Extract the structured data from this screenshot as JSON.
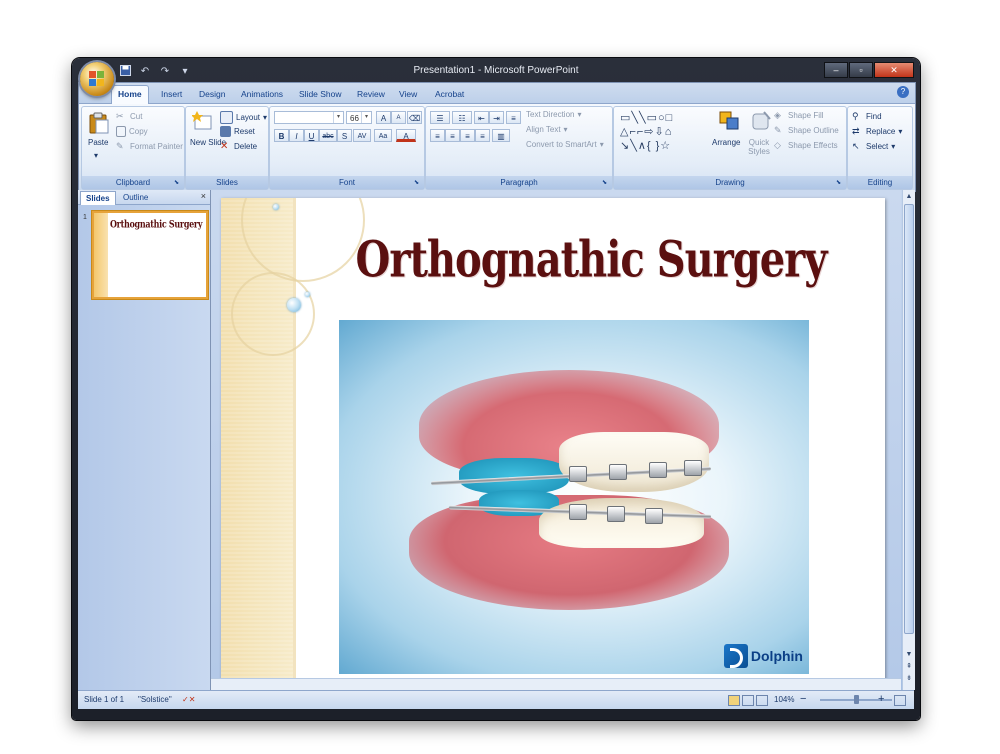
{
  "window": {
    "title": "Presentation1 - Microsoft PowerPoint"
  },
  "qat": {
    "save": "save-icon",
    "undo": "↶",
    "redo": "↷",
    "more": "▾"
  },
  "win_controls": {
    "minimize": "–",
    "maximize": "▫",
    "close": "✕"
  },
  "tabs": [
    "Home",
    "Insert",
    "Design",
    "Animations",
    "Slide Show",
    "Review",
    "View",
    "Acrobat"
  ],
  "help": "?",
  "clipboard": {
    "label": "Clipboard",
    "paste": "Paste",
    "cut": "Cut",
    "copy": "Copy",
    "format_painter": "Format Painter"
  },
  "slides_group": {
    "label": "Slides",
    "new_slide": "New Slide",
    "layout": "Layout",
    "reset": "Reset",
    "delete": "Delete"
  },
  "font": {
    "label": "Font",
    "family": "",
    "size": "66",
    "grow": "A",
    "shrink": "A",
    "bold": "B",
    "italic": "I",
    "underline": "U",
    "strike": "abc",
    "shadow": "S",
    "spacing": "AV",
    "case": "Aa",
    "color": "A"
  },
  "paragraph": {
    "label": "Paragraph",
    "text_direction": "Text Direction",
    "align_text": "Align Text",
    "convert_smartart": "Convert to SmartArt"
  },
  "drawing": {
    "label": "Drawing",
    "arrange": "Arrange",
    "quick_styles": "Quick Styles",
    "shape_fill": "Shape Fill",
    "shape_outline": "Shape Outline",
    "shape_effects": "Shape Effects",
    "shapes_row1": "▭╲╲▭○□",
    "shapes_row2": "△⌐⌐⇨⇩⌂",
    "shapes_row3": "↘╲∧{ }☆"
  },
  "editing": {
    "label": "Editing",
    "find": "Find",
    "replace": "Replace",
    "select": "Select"
  },
  "panel": {
    "tab_slides": "Slides",
    "tab_outline": "Outline",
    "close": "×",
    "slide_number": "1",
    "thumb_title": "Orthognathic Surgery"
  },
  "slide": {
    "title": "Orthognathic Surgery",
    "logo_text": "Dolphin"
  },
  "status": {
    "slide_info": "Slide 1 of 1",
    "theme": "\"Solstice\"",
    "zoom": "104%",
    "zoom_out": "−",
    "zoom_in": "+"
  },
  "colors": {
    "title": "#5b1010",
    "accent": "#15428b",
    "band": "#f2dfae"
  }
}
